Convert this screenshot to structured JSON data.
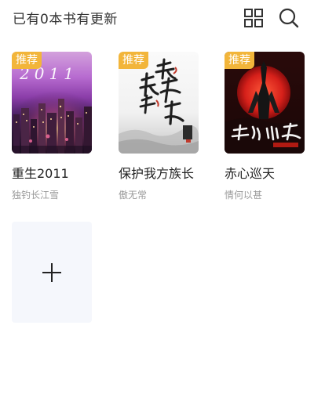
{
  "header": {
    "update_text": "已有0本书有更新",
    "grid_icon": "grid-view-icon",
    "search_icon": "search-icon"
  },
  "books": [
    {
      "title": "重生2011",
      "author": "独钓长江雪",
      "badge": "推荐",
      "cover_text": "2011"
    },
    {
      "title": "保护我方族长",
      "author": "傲无常",
      "badge": "推荐",
      "cover_text": "保护我方族长"
    },
    {
      "title": "赤心巡天",
      "author": "情何以甚",
      "badge": "推荐",
      "cover_text": "赤心巡天"
    }
  ],
  "add_card": {
    "icon": "plus-icon"
  },
  "colors": {
    "badge": "#f2b53a",
    "add_card_bg": "#f5f7fc"
  }
}
